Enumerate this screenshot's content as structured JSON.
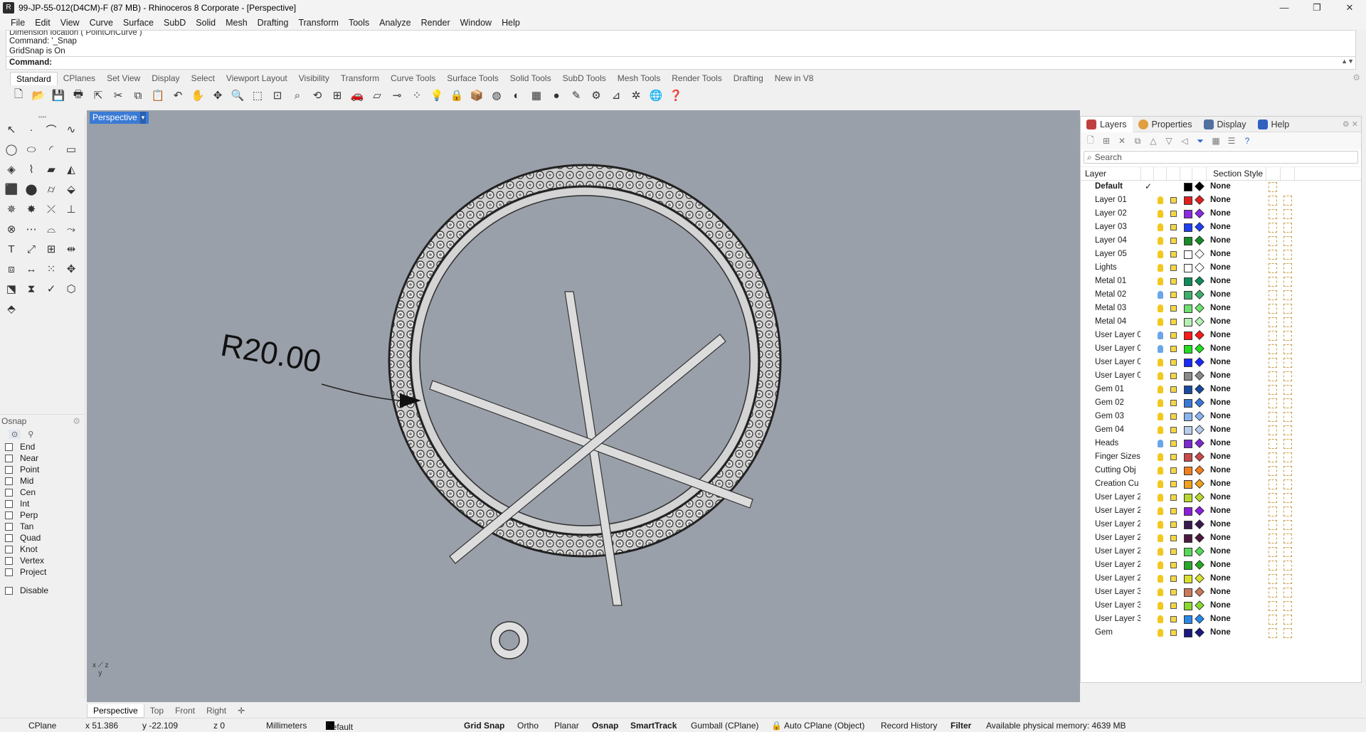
{
  "window": {
    "title": "99-JP-55-012(D4CM)-F (87 MB) - Rhinoceros 8 Corporate - [Perspective]",
    "controls": [
      "—",
      "❐",
      "✕"
    ]
  },
  "menu": [
    "File",
    "Edit",
    "View",
    "Curve",
    "Surface",
    "SubD",
    "Solid",
    "Mesh",
    "Drafting",
    "Transform",
    "Tools",
    "Analyze",
    "Render",
    "Window",
    "Help"
  ],
  "command": {
    "history_cut": "Dimension location ( PointOnCurve )",
    "history": [
      "Command: '_Snap",
      "GridSnap is On"
    ],
    "prompt": "Command:"
  },
  "toolbar_tabs": [
    "Standard",
    "CPlanes",
    "Set View",
    "Display",
    "Select",
    "Viewport Layout",
    "Visibility",
    "Transform",
    "Curve Tools",
    "Surface Tools",
    "Solid Tools",
    "SubD Tools",
    "Mesh Tools",
    "Render Tools",
    "Drafting",
    "New in V8"
  ],
  "viewport": {
    "label": "Perspective",
    "dimension_text": "R20.00",
    "tabs": [
      "Perspective",
      "Top",
      "Front",
      "Right"
    ],
    "add_tab": "✛"
  },
  "osnap": {
    "title": "Osnap",
    "items": [
      "End",
      "Near",
      "Point",
      "Mid",
      "Cen",
      "Int",
      "Perp",
      "Tan",
      "Quad",
      "Knot",
      "Vertex",
      "Project"
    ],
    "disable": "Disable"
  },
  "layers_panel": {
    "tabs": [
      "Layers",
      "Properties",
      "Display",
      "Help"
    ],
    "search_placeholder": "Search",
    "col_layer": "Layer",
    "col_section": "Section Style",
    "rows": [
      {
        "name": "Default",
        "bold": true,
        "check": "✓",
        "color": "#000000",
        "bulb": "none",
        "none": "None"
      },
      {
        "name": "Layer 01",
        "color": "#e02020",
        "bulb": "#f2c81e",
        "none": "None"
      },
      {
        "name": "Layer 02",
        "color": "#8a2be2",
        "bulb": "#f2c81e",
        "none": "None"
      },
      {
        "name": "Layer 03",
        "color": "#1f3ff0",
        "bulb": "#f2c81e",
        "none": "None"
      },
      {
        "name": "Layer 04",
        "color": "#1a8a2a",
        "bulb": "#f2c81e",
        "none": "None"
      },
      {
        "name": "Layer 05",
        "color": "#ffffff",
        "bulb": "#f2c81e",
        "none": "None"
      },
      {
        "name": "Lights",
        "color": "#ffffff",
        "bulb": "#f2c81e",
        "none": "None"
      },
      {
        "name": "Metal 01",
        "color": "#138a5a",
        "bulb": "#f2c81e",
        "none": "None"
      },
      {
        "name": "Metal 02",
        "color": "#3fae6a",
        "bulb": "#6aa6e8",
        "none": "None"
      },
      {
        "name": "Metal 03",
        "color": "#6fe06f",
        "bulb": "#f2c81e",
        "none": "None"
      },
      {
        "name": "Metal 04",
        "color": "#b5f0b5",
        "bulb": "#f2c81e",
        "none": "None"
      },
      {
        "name": "User Layer 0",
        "color": "#ff1a1a",
        "bulb": "#6aa6e8",
        "none": "None"
      },
      {
        "name": "User Layer 0",
        "color": "#22dd22",
        "bulb": "#6aa6e8",
        "none": "None"
      },
      {
        "name": "User Layer 0",
        "color": "#1a2aff",
        "bulb": "#f2c81e",
        "none": "None"
      },
      {
        "name": "User Layer 0",
        "color": "#8a8a8a",
        "bulb": "#f2c81e",
        "none": "None"
      },
      {
        "name": "Gem 01",
        "color": "#1a4aa0",
        "bulb": "#f2c81e",
        "none": "None"
      },
      {
        "name": "Gem 02",
        "color": "#3a78d8",
        "bulb": "#f2c81e",
        "none": "None"
      },
      {
        "name": "Gem 03",
        "color": "#8ab4f0",
        "bulb": "#f2c81e",
        "none": "None"
      },
      {
        "name": "Gem 04",
        "color": "#b8ccec",
        "bulb": "#f2c81e",
        "none": "None"
      },
      {
        "name": "Heads",
        "color": "#7a2ad0",
        "bulb": "#6aa6e8",
        "none": "None"
      },
      {
        "name": "Finger Sizes",
        "color": "#c84a4a",
        "bulb": "#f2c81e",
        "none": "None"
      },
      {
        "name": "Cutting Obj",
        "color": "#f08020",
        "bulb": "#f2c81e",
        "none": "None"
      },
      {
        "name": "Creation Cu",
        "color": "#f0a020",
        "bulb": "#f2c81e",
        "none": "None"
      },
      {
        "name": "User Layer 2",
        "color": "#b8d830",
        "bulb": "#f2c81e",
        "none": "None"
      },
      {
        "name": "User Layer 2",
        "color": "#8a20d8",
        "bulb": "#f2c81e",
        "none": "None"
      },
      {
        "name": "User Layer 2",
        "color": "#3a1a50",
        "bulb": "#f2c81e",
        "none": "None"
      },
      {
        "name": "User Layer 2",
        "color": "#4a1a40",
        "bulb": "#f2c81e",
        "none": "None"
      },
      {
        "name": "User Layer 2",
        "color": "#58d858",
        "bulb": "#f2c81e",
        "none": "None"
      },
      {
        "name": "User Layer 2",
        "color": "#28a828",
        "bulb": "#f2c81e",
        "none": "None"
      },
      {
        "name": "User Layer 2",
        "color": "#d8e030",
        "bulb": "#f2c81e",
        "none": "None"
      },
      {
        "name": "User Layer 3",
        "color": "#c87a5a",
        "bulb": "#f2c81e",
        "none": "None"
      },
      {
        "name": "User Layer 3",
        "color": "#8ad830",
        "bulb": "#f2c81e",
        "none": "None"
      },
      {
        "name": "User Layer 3",
        "color": "#2a88e8",
        "bulb": "#f2c81e",
        "none": "None"
      },
      {
        "name": "Gem",
        "color": "#1a1a80",
        "bulb": "#f2c81e",
        "none": "None"
      }
    ]
  },
  "status": {
    "cplane": "CPlane",
    "x": "x 51.386",
    "y": "y -22.109",
    "z": "z 0",
    "units": "Millimeters",
    "layer": "Default",
    "grid_snap": "Grid Snap",
    "ortho": "Ortho",
    "planar": "Planar",
    "osnap": "Osnap",
    "smarttrack": "SmartTrack",
    "gumball": "Gumball (CPlane)",
    "auto_cplane": "Auto CPlane (Object)",
    "record_history": "Record History",
    "filter": "Filter",
    "memory": "Available physical memory: 4639 MB"
  },
  "colors": {
    "viewport_bg": "#9aa0a9",
    "active_label": "#3a7bd5",
    "metal": "#d8d8d8"
  }
}
